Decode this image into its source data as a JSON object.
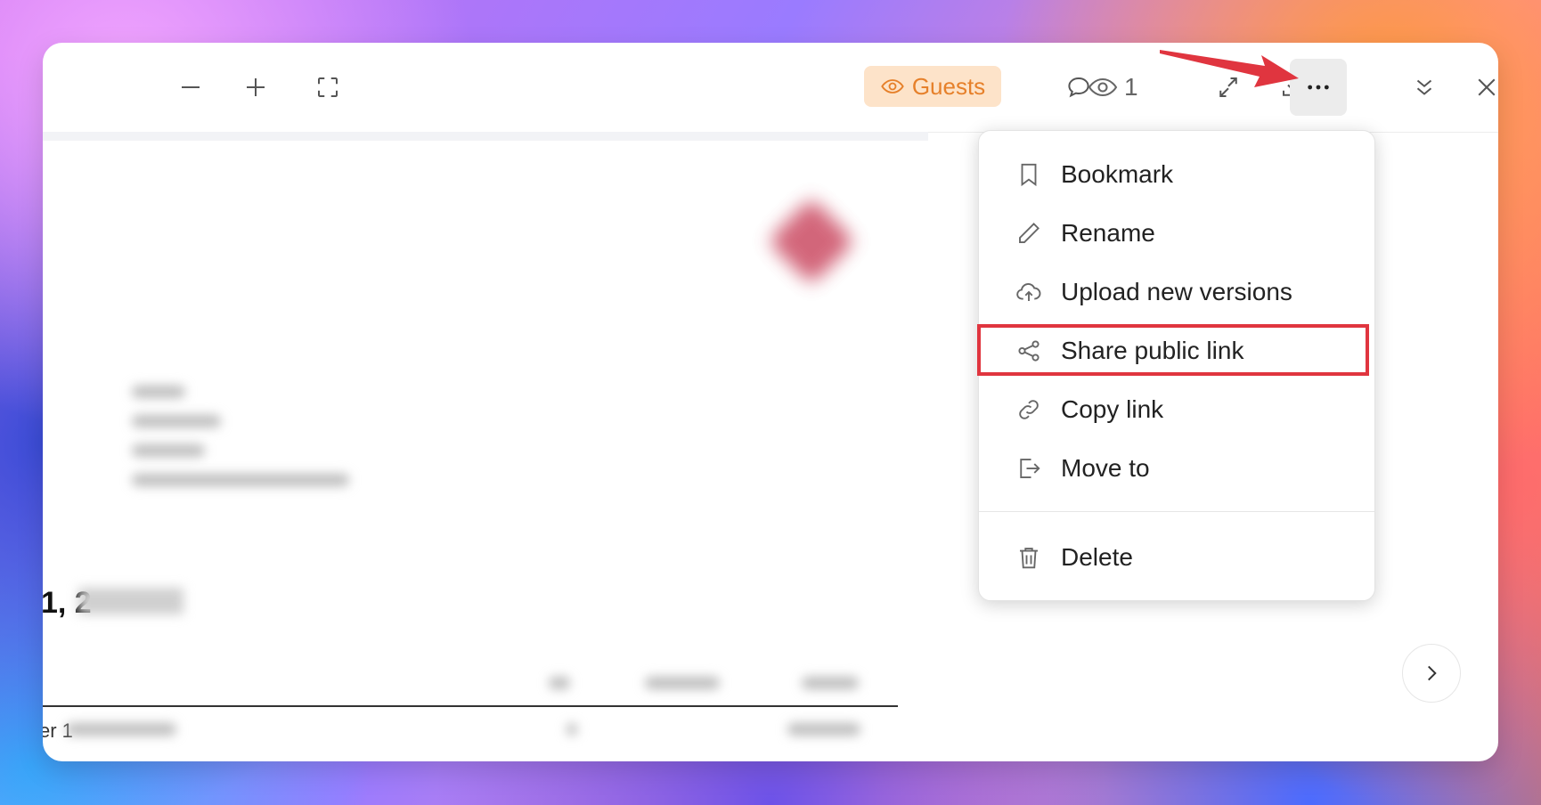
{
  "toolbar": {
    "icons": {
      "zoom_out": "minus-icon",
      "zoom_in": "plus-icon",
      "fullscreen": "fullscreen-icon",
      "comment": "comment-icon",
      "compare": "compare-arrows-icon",
      "download": "download-icon",
      "more": "more-horizontal-icon",
      "collapse": "chevrons-down-icon",
      "close": "close-icon"
    },
    "guests_label": "Guests",
    "viewers_count": "1"
  },
  "document": {
    "date_visible": "1, 2",
    "row_visible": "er 1"
  },
  "menu": {
    "items": [
      {
        "label": "Bookmark",
        "icon": "bookmark-icon"
      },
      {
        "label": "Rename",
        "icon": "pencil-icon"
      },
      {
        "label": "Upload new versions",
        "icon": "cloud-upload-icon"
      },
      {
        "label": "Share public link",
        "icon": "share-icon"
      },
      {
        "label": "Copy link",
        "icon": "link-icon"
      },
      {
        "label": "Move to",
        "icon": "move-out-icon"
      },
      {
        "label": "Delete",
        "icon": "trash-icon"
      }
    ]
  },
  "colors": {
    "highlight": "#e0353f",
    "guests_bg": "#fde3c9",
    "guests_text": "#e6802a",
    "arrow": "#e0353f"
  }
}
